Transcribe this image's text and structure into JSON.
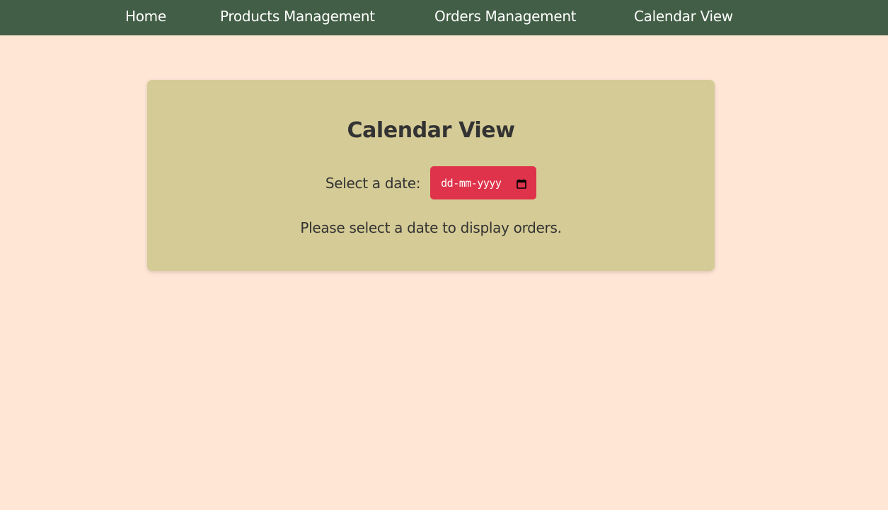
{
  "nav": {
    "items": [
      {
        "label": "Home"
      },
      {
        "label": "Products Management"
      },
      {
        "label": "Orders Management"
      },
      {
        "label": "Calendar View"
      }
    ]
  },
  "calendar": {
    "title": "Calendar View",
    "date_label": "Select a date:",
    "date_placeholder": "dd-mm-yyyy",
    "calendar_icon": "calendar-icon",
    "message": "Please select a date to display orders."
  },
  "colors": {
    "page_background": "#ffe6d5",
    "navbar": "#425e46",
    "card": "#d5cb96",
    "date_input": "#de334a",
    "text": "#333333"
  }
}
